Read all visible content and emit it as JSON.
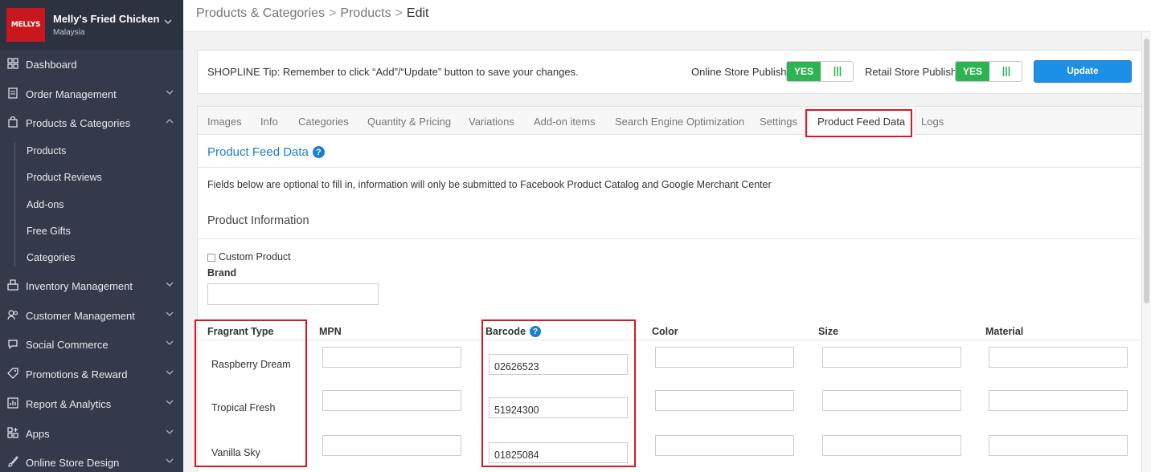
{
  "store": {
    "logo_text": "MELLYS",
    "name": "Melly's Fried Chicken",
    "country": "Malaysia"
  },
  "sidebar": {
    "items": [
      {
        "label": "Dashboard",
        "icon": "dashboard-icon",
        "chevron": false
      },
      {
        "label": "Order Management",
        "icon": "order-icon",
        "chevron": "down"
      },
      {
        "label": "Products & Categories",
        "icon": "bag-icon",
        "chevron": "up"
      },
      {
        "label": "Inventory Management",
        "icon": "inventory-icon",
        "chevron": "down"
      },
      {
        "label": "Customer Management",
        "icon": "customer-icon",
        "chevron": "down"
      },
      {
        "label": "Social Commerce",
        "icon": "chat-icon",
        "chevron": "down"
      },
      {
        "label": "Promotions & Reward",
        "icon": "tag-icon",
        "chevron": "down"
      },
      {
        "label": "Report & Analytics",
        "icon": "chart-icon",
        "chevron": "down"
      },
      {
        "label": "Apps",
        "icon": "apps-icon",
        "chevron": "down"
      },
      {
        "label": "Online Store Design",
        "icon": "brush-icon",
        "chevron": "down"
      }
    ],
    "sub_items": [
      "Products",
      "Product Reviews",
      "Add-ons",
      "Free Gifts",
      "Categories"
    ]
  },
  "breadcrumb": {
    "level1": "Products & Categories",
    "level2": "Products",
    "current": "Edit",
    "separator": ">"
  },
  "tip": {
    "text": "SHOPLINE Tip: Remember to click “Add”/“Update” button to save your changes.",
    "online_label": "Online Store Publish",
    "online_value": "YES",
    "retail_label": "Retail Store Publish",
    "retail_value": "YES",
    "update_label": "Update"
  },
  "tabs": [
    "Images",
    "Info",
    "Categories",
    "Quantity & Pricing",
    "Variations",
    "Add-on items",
    "Search Engine Optimization",
    "Settings",
    "Product Feed Data",
    "Logs"
  ],
  "active_tab": "Product Feed Data",
  "feed": {
    "title": "Product Feed Data",
    "description": "Fields below are optional to fill in, information will only be submitted to Facebook Product Catalog and Google Merchant Center",
    "product_info_title": "Product Information",
    "custom_product_label": "Custom Product",
    "brand_label": "Brand",
    "brand_value": "",
    "columns": [
      "Fragrant Type",
      "MPN",
      "Barcode",
      "Color",
      "Size",
      "Material"
    ],
    "rows": [
      {
        "variant": "Raspberry Dream",
        "mpn": "",
        "barcode": "02626523",
        "color": "",
        "size": "",
        "material": ""
      },
      {
        "variant": "Tropical Fresh",
        "mpn": "",
        "barcode": "51924300",
        "color": "",
        "size": "",
        "material": ""
      },
      {
        "variant": "Vanilla Sky",
        "mpn": "",
        "barcode": "01825084",
        "color": "",
        "size": "",
        "material": ""
      }
    ]
  },
  "colors": {
    "sidebar_bg": "#343a4a",
    "accent": "#1a7fd0",
    "toggle_green": "#2eb352",
    "highlight_red": "#d8181f",
    "update_blue": "#1e8fe6"
  }
}
